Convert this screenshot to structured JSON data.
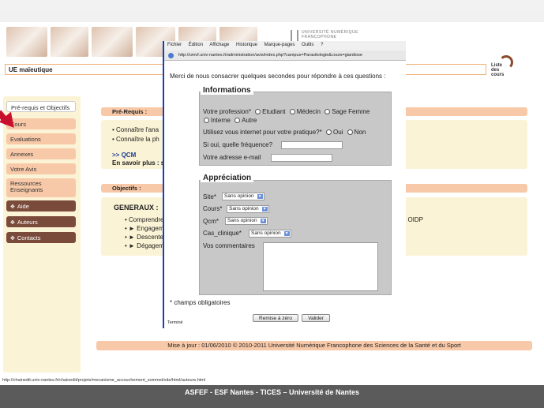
{
  "page": {
    "title": "UE maïeutique",
    "liste_cours_label": "Liste des cours",
    "logo_text": "UNIVERSITÉ NUMÉRIQUE FRANCOPHONE"
  },
  "sidebar": {
    "items": [
      {
        "label": "Pré-requis et Objectifs"
      },
      {
        "label": "Cours"
      },
      {
        "label": "Evaluations"
      },
      {
        "label": "Annexes"
      },
      {
        "label": "Votre Avis"
      },
      {
        "label": "Ressources Enseignants"
      },
      {
        "label": "Aide"
      },
      {
        "label": "Auteurs"
      },
      {
        "label": "Contacts"
      }
    ]
  },
  "content": {
    "prerequis_head": "Pré-Requis :",
    "prerequis_lines": [
      "• Connaître l'ana",
      "• Connaître la ph"
    ],
    "qcm": ">> QCM",
    "en_savoir": "En savoir plus : s",
    "objectifs_head": "Objectifs :",
    "generaux": "GENERAUX :",
    "obj_lines": [
      "• Comprendre",
      "• ► Engagem",
      "• ► Descente",
      "• ► Dégagem"
    ],
    "oidp": "t OIDP"
  },
  "footer": {
    "update": "Mise à jour : 01/06/2010 © 2010-2011 Université Numérique Francophone des Sciences de la Santé et du Sport",
    "status_url": "http://chainedit.univ-nantes.fr/chainedit/projets/mecanisme_accouchement_sommet/site/html/auteurs.html",
    "bottom": "ASFEF - ESF Nantes - TICES – Université de Nantes"
  },
  "popup": {
    "menu": [
      "Fichier",
      "Édition",
      "Affichage",
      "Historique",
      "Marque-pages",
      "Outils",
      "?"
    ],
    "url": "http://umvf.univ-nantes.fr/administration/avis/index.php?campus=Parasitologie&cours=giardiose",
    "intro": "Merci de nous consacrer quelques secondes pour répondre à ces questions :",
    "informations": {
      "legend": "Informations",
      "profession_label": "Votre profession*",
      "professions": [
        "Etudiant",
        "Médecin",
        "Sage Femme",
        "Interne",
        "Autre"
      ],
      "internet_label": "Utilisez vous internet pour votre pratique?*",
      "internet_options": [
        "Oui",
        "Non"
      ],
      "frequence_label": "Si oui, quelle fréquence?",
      "email_label": "Votre adresse e-mail"
    },
    "appreciation": {
      "legend": "Appréciation",
      "rows": [
        {
          "label": "Site*",
          "value": "Sans opinion"
        },
        {
          "label": "Cours*",
          "value": "Sans opinion"
        },
        {
          "label": "Qcm*",
          "value": "Sans opinion"
        },
        {
          "label": "Cas_clinique*",
          "value": "Sans opinion"
        }
      ],
      "comments_label": "Vos commentaires"
    },
    "required_note": "* champs obligatoires",
    "reset_label": "Remise à zéro",
    "submit_label": "Valider",
    "status": "Terminé"
  }
}
